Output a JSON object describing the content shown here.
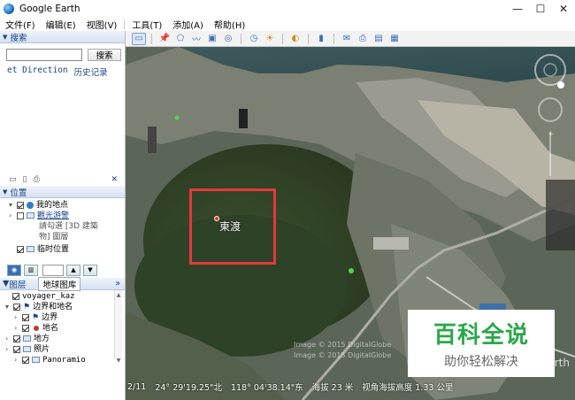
{
  "window": {
    "title": "Google Earth"
  },
  "menu": [
    "文件(F)",
    "编辑(E)",
    "视图(V)",
    "工具(T)",
    "添加(A)",
    "帮助(H)"
  ],
  "search": {
    "header": "搜索",
    "input_value": "",
    "button_label": "搜索",
    "tab_direction": "et Direction",
    "tab_history": "历史记录"
  },
  "places": {
    "header": "位置",
    "my_places": "我的地点",
    "sightseeing": "觀光游警",
    "hint_line1": "請勾選 [3D 建築",
    "hint_line2": "物] 圖層",
    "temporary": "临时位置"
  },
  "layers": {
    "header": "图层",
    "gallery_button": "地球图库",
    "more": "»",
    "items": [
      {
        "label": "voyager_kaz",
        "checked": true
      },
      {
        "label": "边界和地名",
        "checked": true
      },
      {
        "label": "边界",
        "checked": true
      },
      {
        "label": "地名",
        "checked": true
      },
      {
        "label": "地方",
        "checked": true
      },
      {
        "label": "照片",
        "checked": true
      },
      {
        "label": "Panoramio",
        "checked": true
      }
    ]
  },
  "map": {
    "place_label": "東渡",
    "watermark_line1": "Image © 2015 DigitalGlobe",
    "watermark_line2": "Image © 2015 DigitalGlobe",
    "status_date": "2/11",
    "status_lat": "24° 29'19.25\"北",
    "status_lon": "118° 04'38.14\"东",
    "status_elev": "海拔    23 米",
    "status_eye": "视角海拔高度    1.33 公里",
    "earth_tag": "rth"
  },
  "brand": {
    "main": "百科全说",
    "sub": "助你轻松解决",
    "color": "#2aa84a"
  },
  "colors": {
    "highlight": "#e23a3a",
    "panel_header_text": "#15428b"
  }
}
